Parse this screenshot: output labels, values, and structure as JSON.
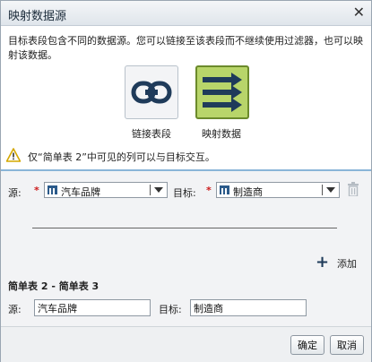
{
  "dialog": {
    "title": "映射数据源",
    "close_label": "✕",
    "description": "目标表段包含不同的数据源。您可以链接至该表段而不继续使用过滤器，也可以映射该数据。"
  },
  "choices": {
    "link_label": "链接表段",
    "map_label": "映射数据",
    "selected": "map"
  },
  "warning": {
    "text": "仅“简单表 2”中可见的列可以与目标交互。"
  },
  "mapping": {
    "source_label": "源:",
    "target_label": "目标:",
    "required_mark": "*",
    "source_value": "汽车品牌",
    "target_value": "制造商",
    "add_label": "添加",
    "add_icon": "plus-icon",
    "section_title": "简单表 2 - 简单表 3",
    "row_source_label": "源:",
    "row_target_label": "目标:",
    "row_source_value": "汽车品牌",
    "row_target_value": "制造商"
  },
  "footer": {
    "ok_label": "确定",
    "cancel_label": "取消"
  },
  "colors": {
    "map_tile": "#b8d56a",
    "icon_navy": "#1f3b5a",
    "warning_yellow": "#e6b800",
    "required_red": "#cc1a1a"
  }
}
